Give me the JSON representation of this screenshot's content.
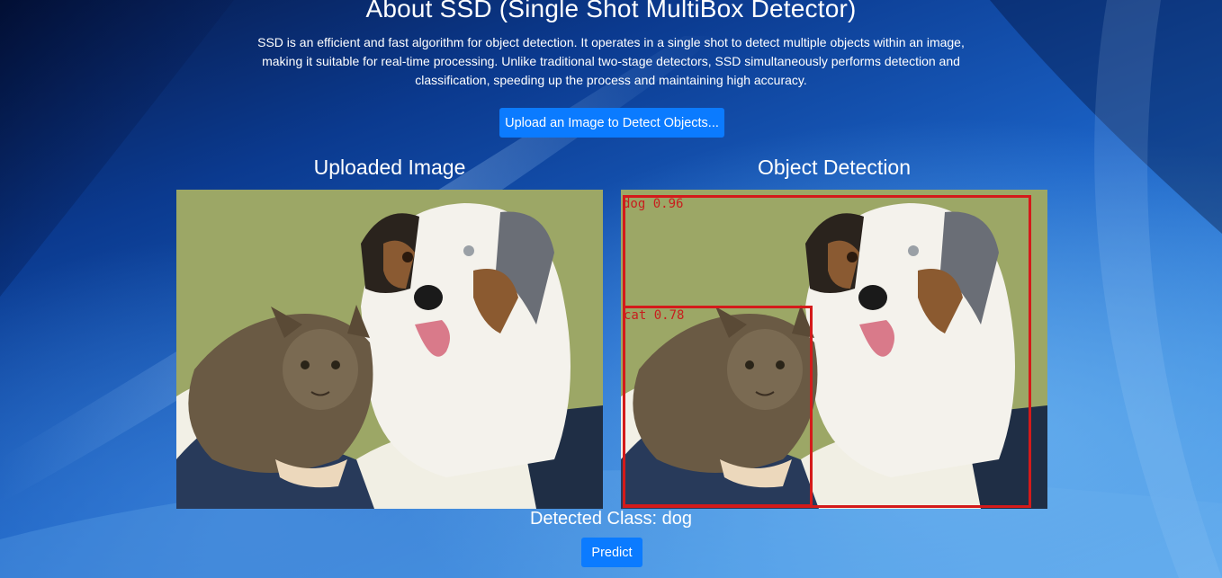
{
  "header": {
    "title": "About SSD (Single Shot MultiBox Detector)",
    "description": "SSD is an efficient and fast algorithm for object detection. It operates in a single shot to detect multiple objects within an image, making it suitable for real-time processing. Unlike traditional two-stage detectors, SSD simultaneously performs detection and classification, speeding up the process and maintaining high accuracy."
  },
  "upload_button": {
    "label": "Upload an Image to Detect Objects..."
  },
  "panels": {
    "uploaded": {
      "title": "Uploaded Image"
    },
    "detection": {
      "title": "Object Detection",
      "detections": [
        {
          "label": "dog 0.96",
          "class": "dog",
          "score": 0.96
        },
        {
          "label": "cat 0.78",
          "class": "cat",
          "score": 0.78
        }
      ]
    }
  },
  "result": {
    "detected_class_text": "Detected Class: dog"
  },
  "predict_button": {
    "label": "Predict"
  },
  "colors": {
    "accent": "#0b7bff",
    "bbox": "#d41a1a",
    "image_background": "#9ea868"
  }
}
